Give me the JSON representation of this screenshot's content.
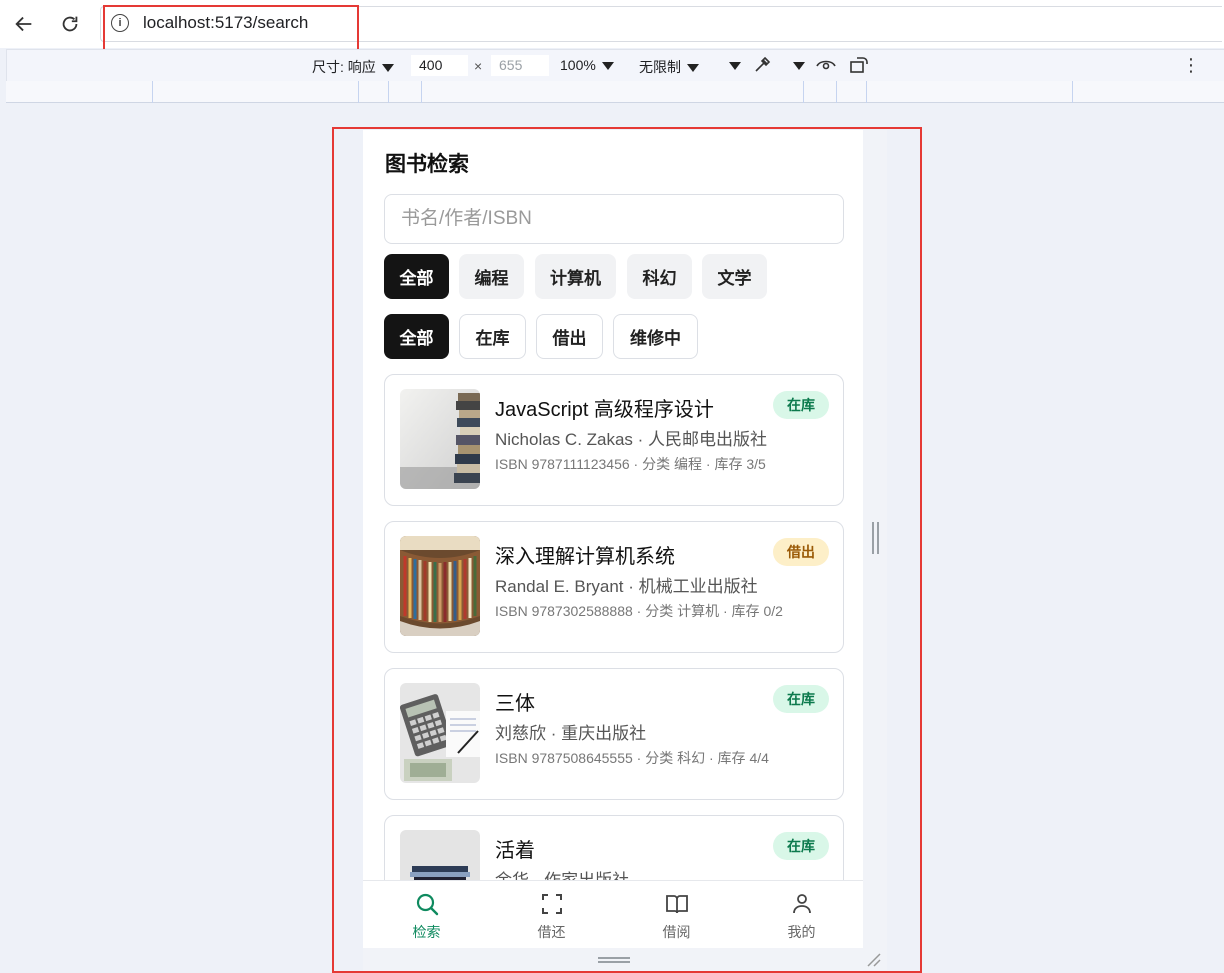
{
  "browser": {
    "url": "localhost:5173/search"
  },
  "devtools": {
    "size_label": "尺寸: 响应",
    "width": "400",
    "height_placeholder": "655",
    "zoom": "100%",
    "throttle": "无限制"
  },
  "app": {
    "title": "图书检索",
    "search_placeholder": "书名/作者/ISBN",
    "categories": [
      "全部",
      "编程",
      "计算机",
      "科幻",
      "文学"
    ],
    "active_category": "全部",
    "statuses": [
      "全部",
      "在库",
      "借出",
      "维修中"
    ],
    "active_status": "全部",
    "books": [
      {
        "title": "JavaScript 高级程序设计",
        "meta": "Nicholas C. Zakas · 人民邮电出版社",
        "info": "ISBN 9787111123456 · 分类 编程 · 库存 3/5",
        "status": "在库",
        "status_color": "#0c7a4d"
      },
      {
        "title": "深入理解计算机系统",
        "meta": "Randal E. Bryant · 机械工业出版社",
        "info": "ISBN 9787302588888 · 分类 计算机 · 库存 0/2",
        "status": "借出",
        "status_color": "#9a5a06"
      },
      {
        "title": "三体",
        "meta": "刘慈欣 · 重庆出版社",
        "info": "ISBN 9787508645555 · 分类 科幻 · 库存 4/4",
        "status": "在库",
        "status_color": "#0c7a4d"
      },
      {
        "title": "活着",
        "meta": "余华 · 作家出版社",
        "info": "",
        "status": "在库",
        "status_color": "#0c7a4d"
      }
    ],
    "tabs": [
      {
        "label": "检索",
        "icon": "search-icon"
      },
      {
        "label": "借还",
        "icon": "scan-icon"
      },
      {
        "label": "借阅",
        "icon": "book-icon"
      },
      {
        "label": "我的",
        "icon": "user-icon"
      }
    ],
    "accent": "#0f8a5f"
  }
}
